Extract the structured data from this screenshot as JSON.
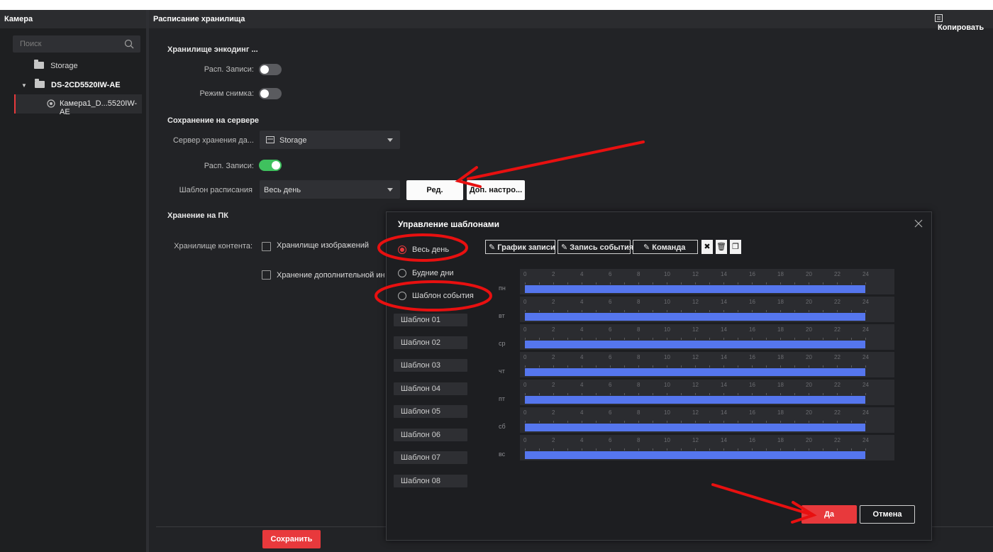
{
  "left": {
    "title": "Камера",
    "search_placeholder": "Поиск",
    "tree": [
      {
        "label": "Storage"
      },
      {
        "label": "DS-2CD5520IW-AE"
      },
      {
        "label": "Камера1_D...5520IW-AE"
      }
    ]
  },
  "main": {
    "title": "Расписание хранилища",
    "copy_label": "Копировать",
    "encoding_section": "Хранилище энкодинг ...",
    "rec_schedule_label": "Расп. Записи:",
    "snapshot_label": "Режим снимка:",
    "server_section": "Сохранение на сервере",
    "storage_server_label": "Сервер хранения да...",
    "storage_server_value": "Storage",
    "server_rec_label": "Расп. Записи:",
    "template_label": "Шаблон расписания",
    "template_value": "Весь день",
    "edit_button": "Ред.",
    "advanced_button": "Доп. настро...",
    "pc_section": "Хранение на ПК",
    "content_label": "Хранилище контента:",
    "images_checkbox": "Хранилище изображений",
    "extra_checkbox": "Хранение дополнительной ин",
    "save_button": "Сохранить",
    "toggles": {
      "rec_schedule": false,
      "snapshot": false,
      "server_rec": true
    }
  },
  "dialog": {
    "title": "Управление шаблонами",
    "radios": [
      "Весь день",
      "Будние дни",
      "Шаблон события"
    ],
    "selected_radio": "Весь день",
    "templates": [
      "Шаблон 01",
      "Шаблон 02",
      "Шаблон 03",
      "Шаблон 04",
      "Шаблон 05",
      "Шаблон 06",
      "Шаблон 07",
      "Шаблон 08"
    ],
    "toolbar": {
      "record_schedule": "График записи",
      "event_record": "Запись события",
      "command": "Команда",
      "icons": [
        "close-x-icon",
        "delete-icon",
        "copy-icon"
      ]
    },
    "days": [
      "пн",
      "вт",
      "ср",
      "чт",
      "пт",
      "сб",
      "вс"
    ],
    "hour_ticks": [
      "0",
      "2",
      "4",
      "6",
      "8",
      "10",
      "12",
      "14",
      "16",
      "18",
      "20",
      "22",
      "24"
    ],
    "yes_button": "Да",
    "cancel_button": "Отмена"
  },
  "colors": {
    "accent": "#e8393c",
    "toggle_on": "#3fc15e",
    "schedule_bar": "#5576ee",
    "annotation": "#e81010"
  }
}
